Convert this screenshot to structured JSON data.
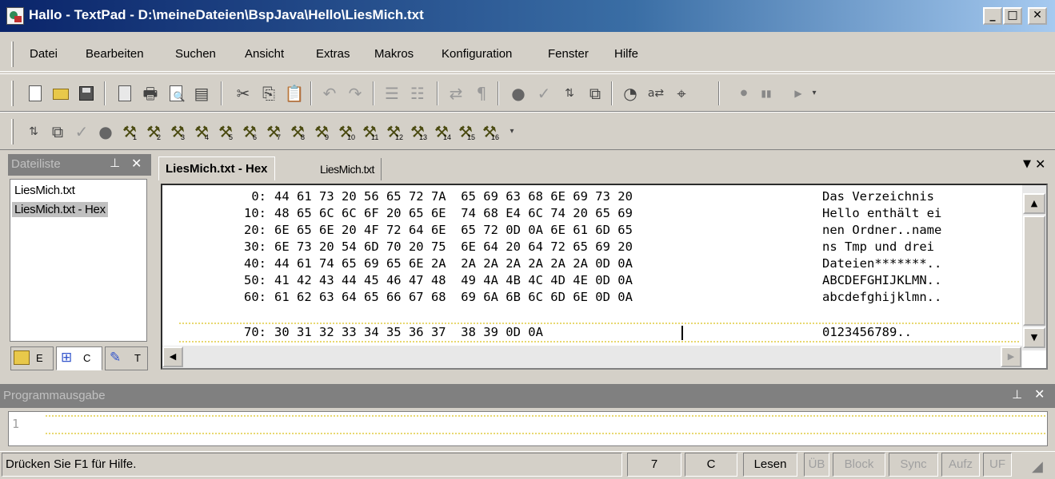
{
  "window": {
    "title": "Hallo - TextPad - D:\\meineDateien\\BspJava\\Hello\\LiesMich.txt",
    "minimize": "_",
    "maximize": "□",
    "close": "✕"
  },
  "menu": [
    {
      "label": "Datei"
    },
    {
      "label": "Bearbeiten"
    },
    {
      "label": "Suchen"
    },
    {
      "label": "Ansicht"
    },
    {
      "label": "Extras"
    },
    {
      "label": "Makros"
    },
    {
      "label": "Konfiguration"
    },
    {
      "label": "Fenster"
    },
    {
      "label": "Hilfe"
    }
  ],
  "toolbar2": {
    "hammer_numbers": [
      "1",
      "2",
      "3",
      "4",
      "5",
      "6",
      "7",
      "8",
      "9",
      "10",
      "11",
      "12",
      "13",
      "14",
      "15",
      "16"
    ]
  },
  "side_panel": {
    "title": "Dateiliste",
    "items": [
      "LiesMich.txt",
      "LiesMich.txt - Hex"
    ],
    "selected_index": 1,
    "tabs": [
      "E",
      "C",
      "T"
    ]
  },
  "doc_tabs": [
    {
      "label": "LiesMich.txt - Hex",
      "active": true
    },
    {
      "label": "LiesMich.txt",
      "active": false
    }
  ],
  "hex_view": {
    "rows": [
      {
        "offset": "0:",
        "bytes": "44 61 73 20 56 65 72 7A  65 69 63 68 6E 69 73 20",
        "text": "Das Verzeichnis "
      },
      {
        "offset": "10:",
        "bytes": "48 65 6C 6C 6F 20 65 6E  74 68 E4 6C 74 20 65 69",
        "text": "Hello enthält ei"
      },
      {
        "offset": "20:",
        "bytes": "6E 65 6E 20 4F 72 64 6E  65 72 0D 0A 6E 61 6D 65",
        "text": "nen Ordner..name"
      },
      {
        "offset": "30:",
        "bytes": "6E 73 20 54 6D 70 20 75  6E 64 20 64 72 65 69 20",
        "text": "ns Tmp und drei "
      },
      {
        "offset": "40:",
        "bytes": "44 61 74 65 69 65 6E 2A  2A 2A 2A 2A 2A 2A 0D 0A",
        "text": "Dateien*******.."
      },
      {
        "offset": "50:",
        "bytes": "41 42 43 44 45 46 47 48  49 4A 4B 4C 4D 4E 0D 0A",
        "text": "ABCDEFGHIJKLMN.."
      },
      {
        "offset": "60:",
        "bytes": "61 62 63 64 65 66 67 68  69 6A 6B 6C 6D 6E 0D 0A",
        "text": "abcdefghijklmn.."
      },
      {
        "offset": "70:",
        "bytes": "30 31 32 33 34 35 36 37  38 39 0D 0A ",
        "text": "0123456789.."
      }
    ]
  },
  "output_panel": {
    "title": "Programmausgabe",
    "line_number": "1"
  },
  "statusbar": {
    "help": "Drücken Sie F1 für Hilfe.",
    "line": "7",
    "column": "C",
    "mode": "Lesen",
    "ub": "ÜB",
    "block": "Block",
    "sync": "Sync",
    "aufz": "Aufz",
    "uf": "UF"
  }
}
